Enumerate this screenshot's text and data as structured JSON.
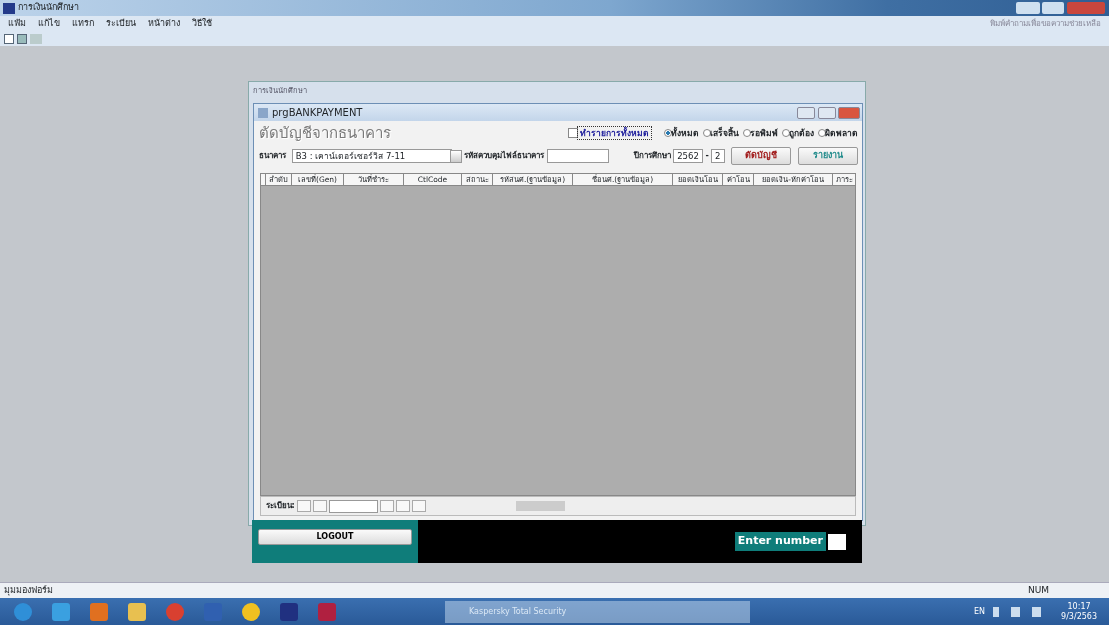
{
  "app": {
    "title": "การเงินนักศึกษา",
    "menu": [
      "แฟ้ม",
      "แก้ไข",
      "แทรก",
      "ระเบียน",
      "หน้าต่าง",
      "วิธีใช้"
    ],
    "help_placeholder": "พิมพ์คำถามเพื่อขอความช่วยเหลือ"
  },
  "mdi": {
    "title": "การเงินนักศึกษา"
  },
  "form": {
    "title": "prgBANKPAYMENT",
    "heading": "ตัดบัญชีจากธนาคาร",
    "select_all": {
      "label": "ทำรายการทั้งหมด",
      "checked": false
    },
    "filters": [
      {
        "label": "ทั้งหมด",
        "selected": true
      },
      {
        "label": "เสร็จสิ้น",
        "selected": false
      },
      {
        "label": "รอพิมพ์",
        "selected": false
      },
      {
        "label": "ถูกต้อง",
        "selected": false
      },
      {
        "label": "ผิดพลาด",
        "selected": false
      }
    ],
    "bank": {
      "label": "ธนาคาร",
      "value": "B3 : เคาน์เตอร์เซอร์วิส 7-11"
    },
    "control_code": {
      "label": "รหัสควบคุมไฟล์ธนาคาร"
    },
    "year": {
      "label": "ปีการศึกษา",
      "year": "2562",
      "separator": "-",
      "term": "2"
    },
    "buttons": [
      {
        "label": "ตัดบัญชี",
        "kind": "primary"
      },
      {
        "label": "รายงาน",
        "kind": "secondary"
      }
    ],
    "table": {
      "columns": [
        "ลำดับ",
        "เลขที่(Gen)",
        "วันที่ชำระ",
        "CtlCode",
        "สถานะ",
        "รหัสนศ.(ฐานข้อมูล)",
        "ชื่อนศ.(ฐานข้อมูล)",
        "ยอดเงินโอน",
        "ค่าโอน",
        "ยอดเงิน-หักค่าโอน",
        "ภาระ"
      ]
    },
    "navigator": {
      "label": "ระเบียน:"
    }
  },
  "footer": {
    "logout": "LOGOUT",
    "enter_label": "Enter number"
  },
  "status_bar": {
    "text": "มุมมองฟอร์ม",
    "num": "NUM"
  },
  "taskbar": {
    "window_button": "Kaspersky Total Security",
    "lang": "EN",
    "time": "10:17",
    "date": "9/3/2563"
  }
}
